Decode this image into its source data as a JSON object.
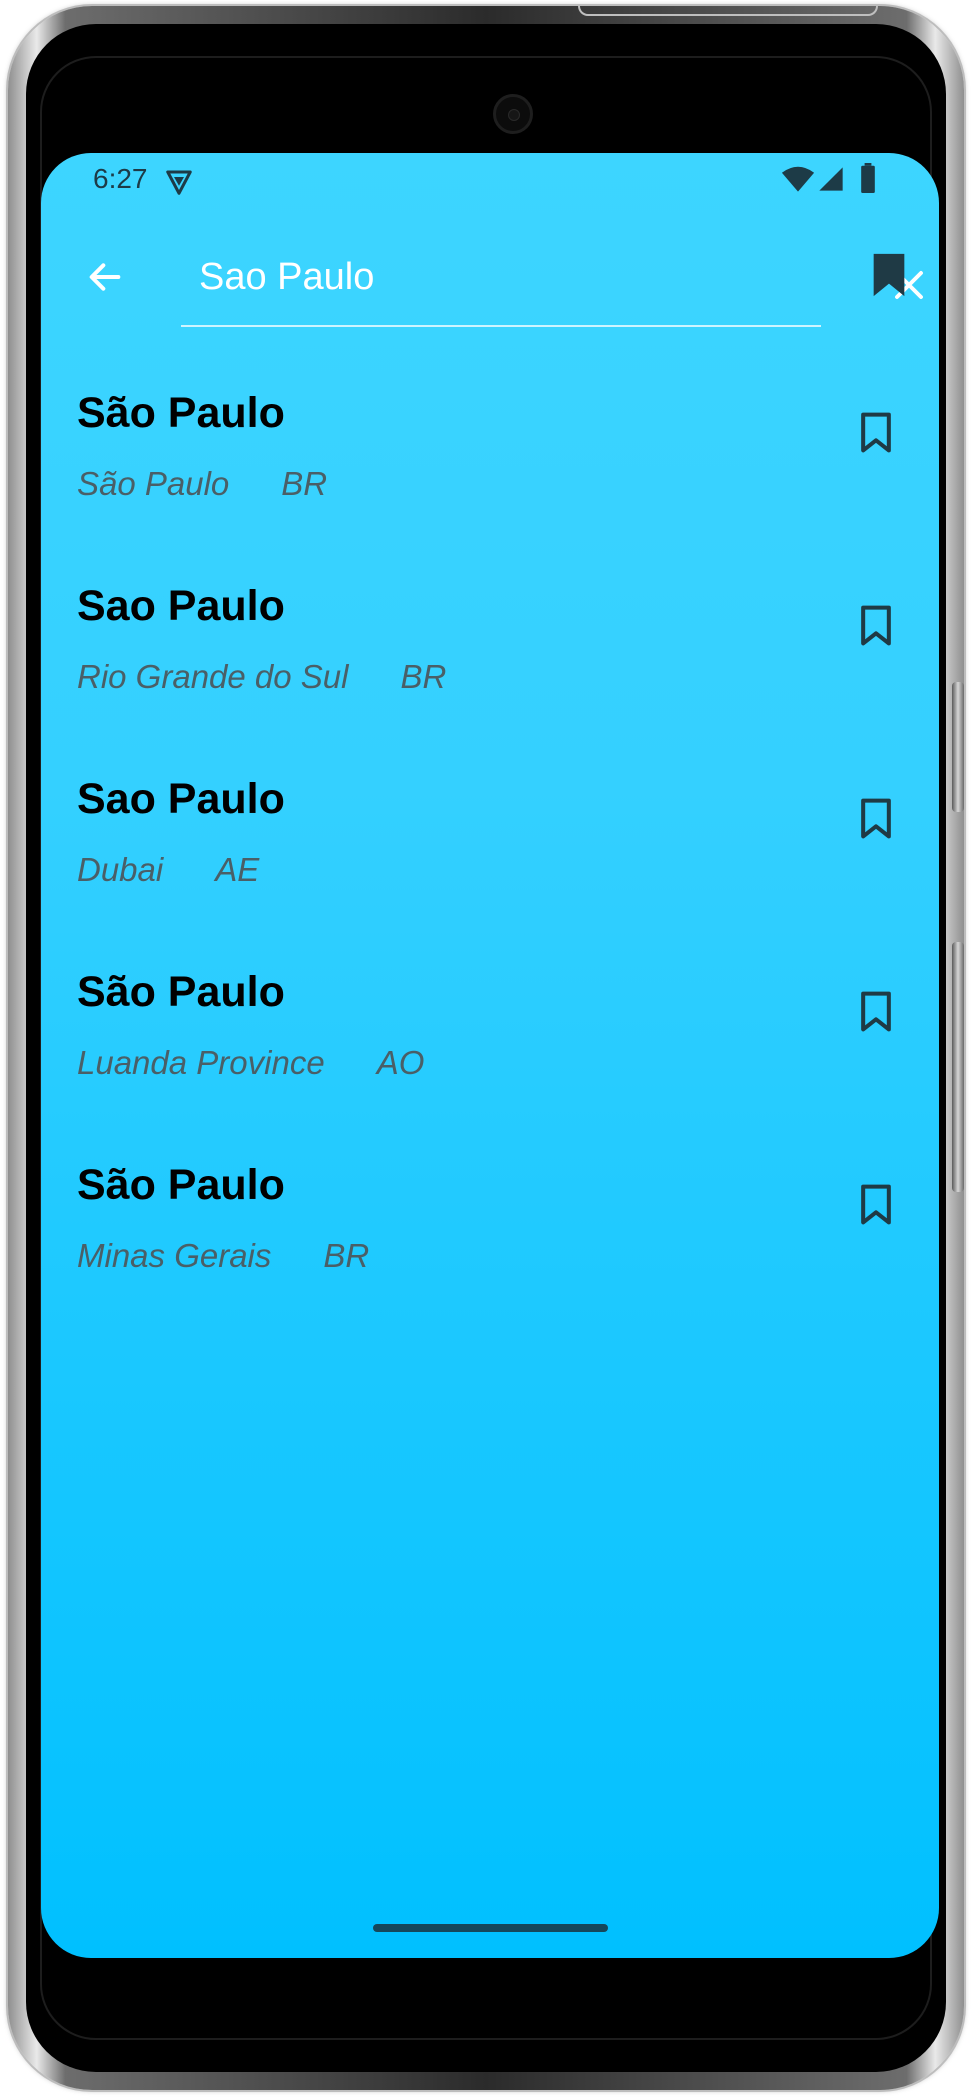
{
  "status_bar": {
    "time": "6:27"
  },
  "search": {
    "query": "Sao Paulo",
    "back_icon": "arrow-left-icon",
    "clear_icon": "close-icon",
    "bookmarks_icon": "bookmark-filled-icon"
  },
  "results": [
    {
      "name": "São Paulo",
      "region": "São Paulo",
      "country": "BR"
    },
    {
      "name": "Sao Paulo",
      "region": "Rio Grande do Sul",
      "country": "BR"
    },
    {
      "name": "Sao Paulo",
      "region": "Dubai",
      "country": "AE"
    },
    {
      "name": "São Paulo",
      "region": "Luanda Province",
      "country": "AO"
    },
    {
      "name": "São Paulo",
      "region": "Minas Gerais",
      "country": "BR"
    }
  ],
  "colors": {
    "background_top": "#3dd5ff",
    "background_bottom": "#00c0ff",
    "title_text": "#000000",
    "subtitle_text": "#4a5f67",
    "icon_dark": "#1f3a45",
    "search_text": "#ffffff"
  }
}
